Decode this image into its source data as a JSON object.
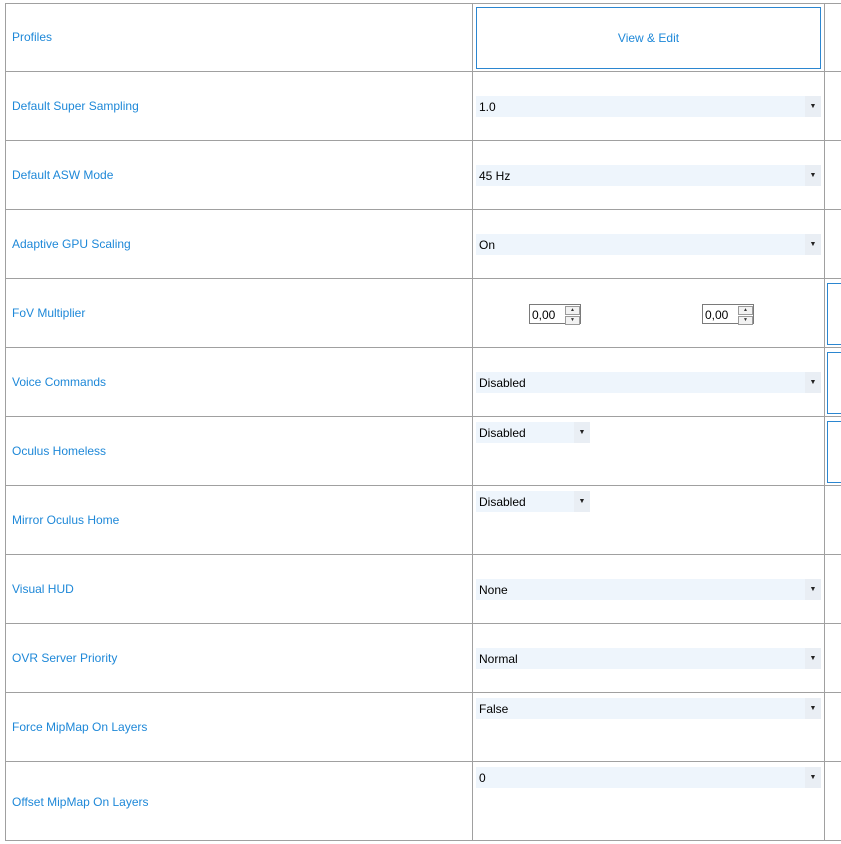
{
  "rows": [
    {
      "label": "Profiles",
      "button": "View & Edit"
    },
    {
      "label": "Default Super Sampling",
      "value": "1.0"
    },
    {
      "label": "Default ASW Mode",
      "value": "45 Hz"
    },
    {
      "label": "Adaptive GPU Scaling",
      "value": "On"
    },
    {
      "label": "FoV Multiplier",
      "fov_h": "0,00",
      "fov_v": "0,00"
    },
    {
      "label": "Voice Commands",
      "value": "Disabled"
    },
    {
      "label": "Oculus Homeless",
      "value": "Disabled"
    },
    {
      "label": "Mirror Oculus Home",
      "value": "Disabled"
    },
    {
      "label": "Visual HUD",
      "value": "None"
    },
    {
      "label": "OVR Server Priority",
      "value": "Normal"
    },
    {
      "label": "Force MipMap On Layers",
      "value": "False"
    },
    {
      "label": "Offset MipMap On Layers",
      "value": "0"
    }
  ],
  "icons": {
    "dropdown_arrow": "chevron-down-icon",
    "spin_up": "spin-up-icon",
    "spin_down": "spin-down-icon"
  },
  "colors": {
    "label_text": "#1e88d8",
    "combo_bg": "#eef5fc",
    "grid_line": "#a0a0a0",
    "button_border": "#2b86d0"
  }
}
